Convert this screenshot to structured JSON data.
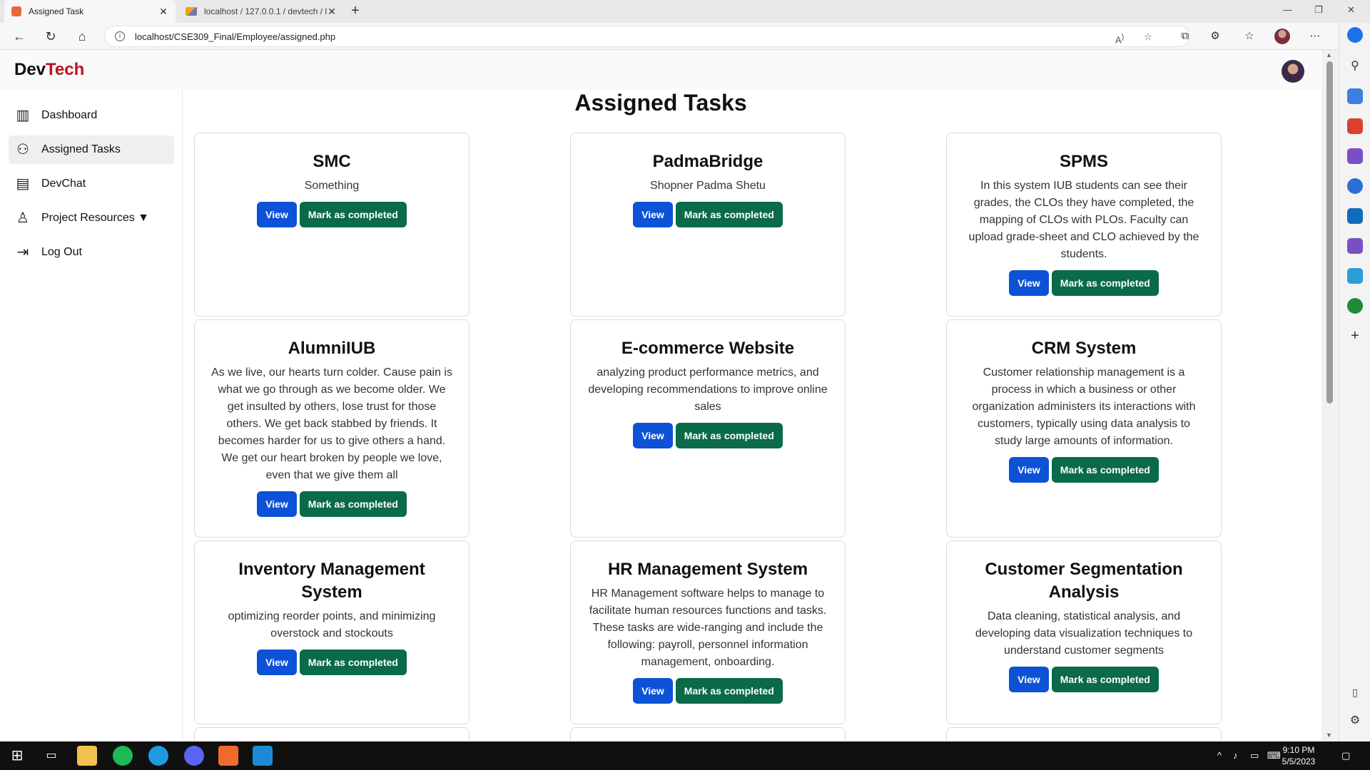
{
  "browser": {
    "tabs": [
      {
        "title": "Assigned Task",
        "active": true
      },
      {
        "title": "localhost / 127.0.0.1 / devtech / l",
        "active": false
      }
    ],
    "url": "localhost/CSE309_Final/Employee/assigned.php"
  },
  "app": {
    "brand_part1": "Dev",
    "brand_part2": "Tech",
    "brand_colors": {
      "part1": "#111111",
      "part2": "#c0101f"
    }
  },
  "sidebar": {
    "items": [
      {
        "label": "Dashboard",
        "icon": "dashboard-icon"
      },
      {
        "label": "Assigned Tasks",
        "icon": "team-tasks-icon",
        "active": true
      },
      {
        "label": "DevChat",
        "icon": "chat-icon"
      },
      {
        "label": "Project Resources ▼",
        "icon": "resources-icon"
      },
      {
        "label": "Log Out",
        "icon": "logout-icon"
      }
    ]
  },
  "main": {
    "title": "Assigned Tasks",
    "view_label": "View",
    "complete_label": "Mark as completed",
    "button_colors": {
      "view": "#0d52d6",
      "complete": "#0a6a4a"
    },
    "cards": [
      {
        "title": "SMC",
        "description": "Something"
      },
      {
        "title": "PadmaBridge",
        "description": "Shopner Padma Shetu"
      },
      {
        "title": "SPMS",
        "description": "In this system IUB students can see their grades, the CLOs they have completed, the mapping of CLOs with PLOs. Faculty can upload grade-sheet and CLO achieved by the students."
      },
      {
        "title": "AlumniIUB",
        "description": "As we live, our hearts turn colder. Cause pain is what we go through as we become older. We get insulted by others, lose trust for those others. We get back stabbed by friends. It becomes harder for us to give others a hand. We get our heart broken by people we love, even that we give them all"
      },
      {
        "title": "E-commerce Website",
        "description": "analyzing product performance metrics, and developing recommendations to improve online sales"
      },
      {
        "title": "CRM System",
        "description": "Customer relationship management is a process in which a business or other organization administers its interactions with customers, typically using data analysis to study large amounts of information."
      },
      {
        "title": "Inventory Management System",
        "description": "optimizing reorder points, and minimizing overstock and stockouts"
      },
      {
        "title": "HR Management System",
        "description": "HR Management software helps to manage to facilitate human resources functions and tasks. These tasks are wide-ranging and include the following: payroll, personnel information management, onboarding."
      },
      {
        "title": "Customer Segmentation Analysis",
        "description": "Data cleaning, statistical analysis, and developing data visualization techniques to understand customer segments"
      }
    ]
  },
  "taskbar": {
    "time": "9:10 PM",
    "date": "5/5/2023"
  }
}
